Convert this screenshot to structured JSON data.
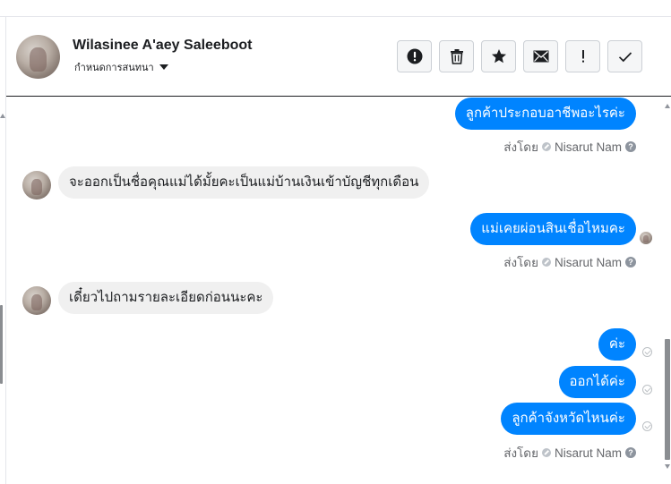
{
  "contact": {
    "name": "Wilasinee A'aey Saleeboot",
    "status_label": "กำหนดการสนทนา"
  },
  "toolbar": {
    "buttons": [
      {
        "icon": "alert-circle-icon",
        "label": "Mark as spam"
      },
      {
        "icon": "trash-icon",
        "label": "Delete"
      },
      {
        "icon": "star-icon",
        "label": "Star"
      },
      {
        "icon": "envelope-icon",
        "label": "Mark as unread"
      },
      {
        "icon": "exclamation-icon",
        "label": "Follow up"
      },
      {
        "icon": "checkmark-icon",
        "label": "Mark as done"
      }
    ]
  },
  "messages": [
    {
      "direction": "outgoing",
      "text": "ลูกค้าประกอบอาชีพอะไรค่ะ"
    },
    {
      "direction": "incoming",
      "text": "จะออกเป็นชื่อคุณแม่ได้มั้ยคะเป็นแม่บ้านเงินเข้าบัญชีทุกเดือน"
    },
    {
      "direction": "outgoing",
      "text": "แม่เคยผ่อนสินเชื่อไหมคะ"
    },
    {
      "direction": "incoming",
      "text": "เดี๋ยวไปถามรายละเอียดก่อนนะคะ"
    },
    {
      "direction": "outgoing",
      "text": "ค่ะ"
    },
    {
      "direction": "outgoing",
      "text": "ออกได้ค่ะ"
    },
    {
      "direction": "outgoing",
      "text": "ลูกค้าจังหวัดไหนค่ะ"
    }
  ],
  "sent_by": {
    "prefix": "ส่งโดย",
    "agent": "Nisarut Nam",
    "help_glyph": "?"
  },
  "colors": {
    "outgoing_bubble": "#0084ff",
    "incoming_bubble": "#f0f0f0",
    "meta_text": "#65676b"
  }
}
